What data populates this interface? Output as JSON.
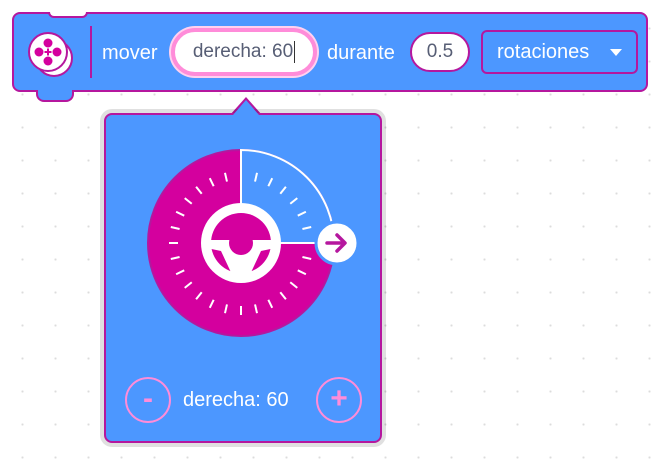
{
  "block": {
    "extension_icon": "move-extension-icon",
    "move_label": "mover",
    "steer_value": "derecha: 60",
    "during_label": "durante",
    "duration_value": "0.5",
    "unit_selected": "rotaciones"
  },
  "panel": {
    "minus_label": "-",
    "plus_label": "+",
    "readout": "derecha: 60",
    "steer_fraction_right": 0.6,
    "arrow_icon": "arrow-right-icon"
  },
  "colors": {
    "block": "#4c97ff",
    "accent": "#d4009e",
    "border": "#b5179e",
    "field_highlight": "#ff8cd9"
  }
}
